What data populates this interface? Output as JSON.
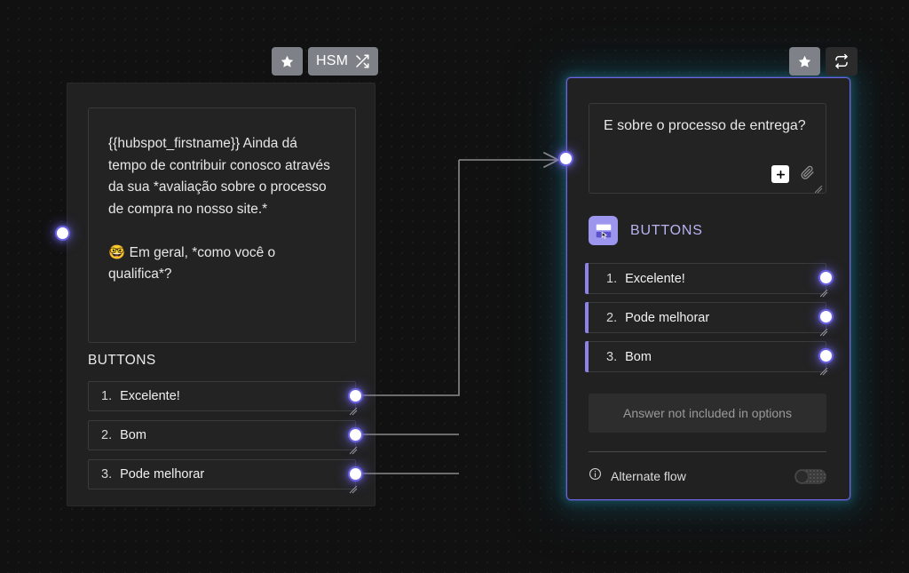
{
  "canvas": {
    "background_color": "#111111",
    "dot_color": "#1e1e1e"
  },
  "toolbar_left": {
    "favorite_icon": "star-icon",
    "hsm_label": "HSM",
    "hsm_icon": "shuffle-icon"
  },
  "toolbar_right": {
    "favorite_icon": "star-icon",
    "repeat_icon": "repeat-icon"
  },
  "node_left": {
    "message": "{{hubspot_firstname}} Ainda dá tempo de contribuir conosco através da sua *avaliação sobre o processo de compra no nosso site.*\n\n🤓 Em geral, *como você o qualifica*?",
    "section_label": "BUTTONS",
    "options": [
      {
        "number": "1.",
        "label": "Excelente!"
      },
      {
        "number": "2.",
        "label": "Bom"
      },
      {
        "number": "3.",
        "label": "Pode melhorar"
      }
    ]
  },
  "node_right": {
    "message": "E sobre o processo de entrega?",
    "add_icon": "plus-icon",
    "attach_icon": "paperclip-icon",
    "type_icon": "buttons-block-icon",
    "type_label": "BUTTONS",
    "options": [
      {
        "number": "1.",
        "label": "Excelente!"
      },
      {
        "number": "2.",
        "label": "Pode melhorar"
      },
      {
        "number": "3.",
        "label": "Bom"
      }
    ],
    "fallback_label": "Answer not included in options",
    "alternate_flow": {
      "info_icon": "info-icon",
      "label": "Alternate flow",
      "toggle_state": "off"
    },
    "selected_border_color": "#6f63e4",
    "glow_color": "#164a58"
  }
}
